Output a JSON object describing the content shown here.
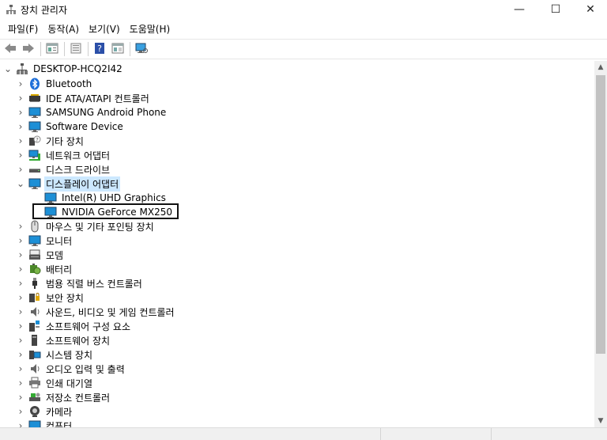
{
  "window": {
    "title": "장치 관리자",
    "controls": {
      "minimize": "—",
      "maximize": "☐",
      "close": "✕"
    }
  },
  "menubar": {
    "items": [
      {
        "label": "파일(F)"
      },
      {
        "label": "동작(A)"
      },
      {
        "label": "보기(V)"
      },
      {
        "label": "도움말(H)"
      }
    ]
  },
  "toolbar": {
    "buttons": [
      "back-icon",
      "forward-icon",
      "properties-icon",
      "update-driver-icon",
      "help-icon",
      "show-hidden-icon",
      "scan-hardware-icon"
    ]
  },
  "tree": {
    "root": {
      "label": "DESKTOP-HCQ2I42",
      "expanded": true
    },
    "items": [
      {
        "label": "Bluetooth",
        "icon": "bluetooth-icon",
        "expanded": false
      },
      {
        "label": "IDE ATA/ATAPI 컨트롤러",
        "icon": "ide-controller-icon",
        "expanded": false
      },
      {
        "label": "SAMSUNG Android Phone",
        "icon": "phone-device-icon",
        "expanded": false
      },
      {
        "label": "Software Device",
        "icon": "software-device-icon",
        "expanded": false
      },
      {
        "label": "기타 장치",
        "icon": "other-device-icon",
        "expanded": false
      },
      {
        "label": "네트워크 어댑터",
        "icon": "network-adapter-icon",
        "expanded": false
      },
      {
        "label": "디스크 드라이브",
        "icon": "disk-drive-icon",
        "expanded": false
      },
      {
        "label": "디스플레이 어댑터",
        "icon": "display-adapter-icon",
        "expanded": true,
        "selected": true,
        "children": [
          {
            "label": "Intel(R) UHD Graphics",
            "icon": "display-adapter-icon"
          },
          {
            "label": "NVIDIA GeForce MX250",
            "icon": "display-adapter-icon",
            "highlighted": true
          }
        ]
      },
      {
        "label": "마우스 및 기타 포인팅 장치",
        "icon": "mouse-icon",
        "expanded": false
      },
      {
        "label": "모니터",
        "icon": "monitor-icon",
        "expanded": false
      },
      {
        "label": "모뎀",
        "icon": "modem-icon",
        "expanded": false
      },
      {
        "label": "배터리",
        "icon": "battery-icon",
        "expanded": false
      },
      {
        "label": "범용 직렬 버스 컨트롤러",
        "icon": "usb-controller-icon",
        "expanded": false
      },
      {
        "label": "보안 장치",
        "icon": "security-device-icon",
        "expanded": false
      },
      {
        "label": "사운드, 비디오 및 게임 컨트롤러",
        "icon": "sound-icon",
        "expanded": false
      },
      {
        "label": "소프트웨어 구성 요소",
        "icon": "software-component-icon",
        "expanded": false
      },
      {
        "label": "소프트웨어 장치",
        "icon": "software-device-icon",
        "expanded": false
      },
      {
        "label": "시스템 장치",
        "icon": "system-device-icon",
        "expanded": false
      },
      {
        "label": "오디오 입력 및 출력",
        "icon": "audio-io-icon",
        "expanded": false
      },
      {
        "label": "인쇄 대기열",
        "icon": "print-queue-icon",
        "expanded": false
      },
      {
        "label": "저장소 컨트롤러",
        "icon": "storage-controller-icon",
        "expanded": false
      },
      {
        "label": "카메라",
        "icon": "camera-icon",
        "expanded": false
      },
      {
        "label": "컴퓨터",
        "icon": "computer-icon",
        "expanded": false
      }
    ]
  },
  "colors": {
    "selection": "#cce8ff",
    "monitor_blue": "#1c8fd6",
    "scroll_thumb": "#c2c2c2"
  }
}
